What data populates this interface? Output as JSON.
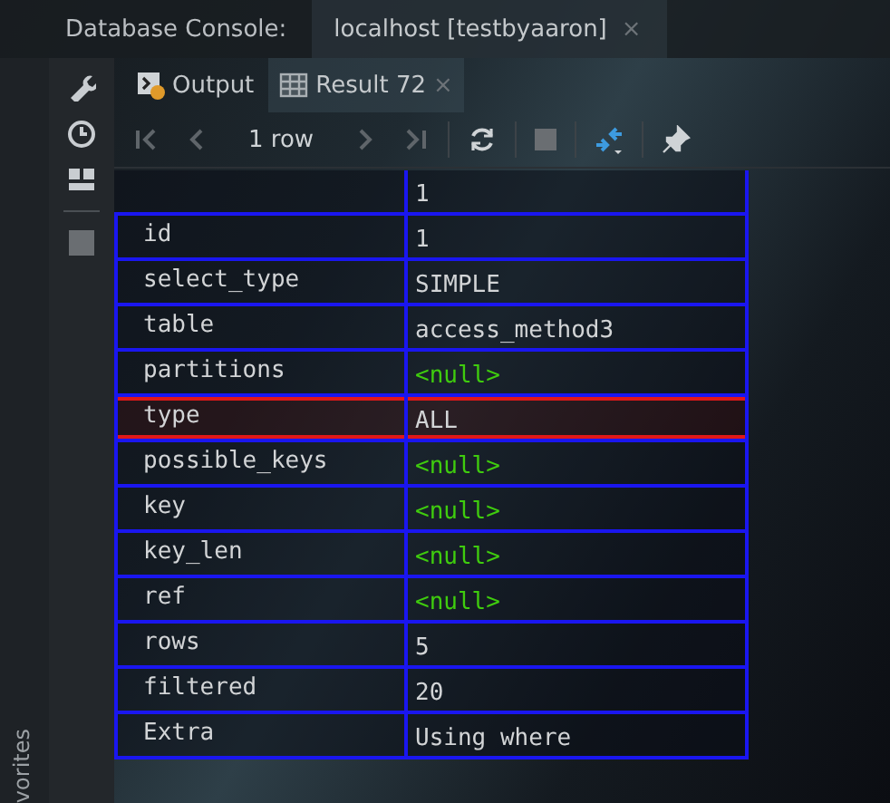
{
  "header": {
    "title": "Database Console:",
    "tab": {
      "label": "localhost [testbyaaron]",
      "close": "×"
    }
  },
  "tool_window": {
    "tabs": [
      {
        "label": "Output",
        "selected": false
      },
      {
        "label": "Result 72",
        "selected": true,
        "close": "×"
      }
    ]
  },
  "toolbar": {
    "row_count": "1 row",
    "first_disabled": true,
    "prev_disabled": true,
    "next_disabled": true,
    "last_disabled": true
  },
  "side_label": "vorites",
  "table": {
    "column_header": "1",
    "rows": [
      {
        "name": "id",
        "value": "1",
        "kind": "text",
        "highlighted": false
      },
      {
        "name": "select_type",
        "value": "SIMPLE",
        "kind": "text",
        "highlighted": false
      },
      {
        "name": "table",
        "value": "access_method3",
        "kind": "text",
        "highlighted": false
      },
      {
        "name": "partitions",
        "value": "<null>",
        "kind": "null",
        "highlighted": false
      },
      {
        "name": "type",
        "value": "ALL",
        "kind": "text",
        "highlighted": true
      },
      {
        "name": "possible_keys",
        "value": "<null>",
        "kind": "null",
        "highlighted": false
      },
      {
        "name": "key",
        "value": "<null>",
        "kind": "null",
        "highlighted": false
      },
      {
        "name": "key_len",
        "value": "<null>",
        "kind": "null",
        "highlighted": false
      },
      {
        "name": "ref",
        "value": "<null>",
        "kind": "null",
        "highlighted": false
      },
      {
        "name": "rows",
        "value": "5",
        "kind": "text",
        "highlighted": false
      },
      {
        "name": "filtered",
        "value": "20",
        "kind": "text",
        "highlighted": false
      },
      {
        "name": "Extra",
        "value": "Using where",
        "kind": "text",
        "highlighted": false
      }
    ]
  }
}
